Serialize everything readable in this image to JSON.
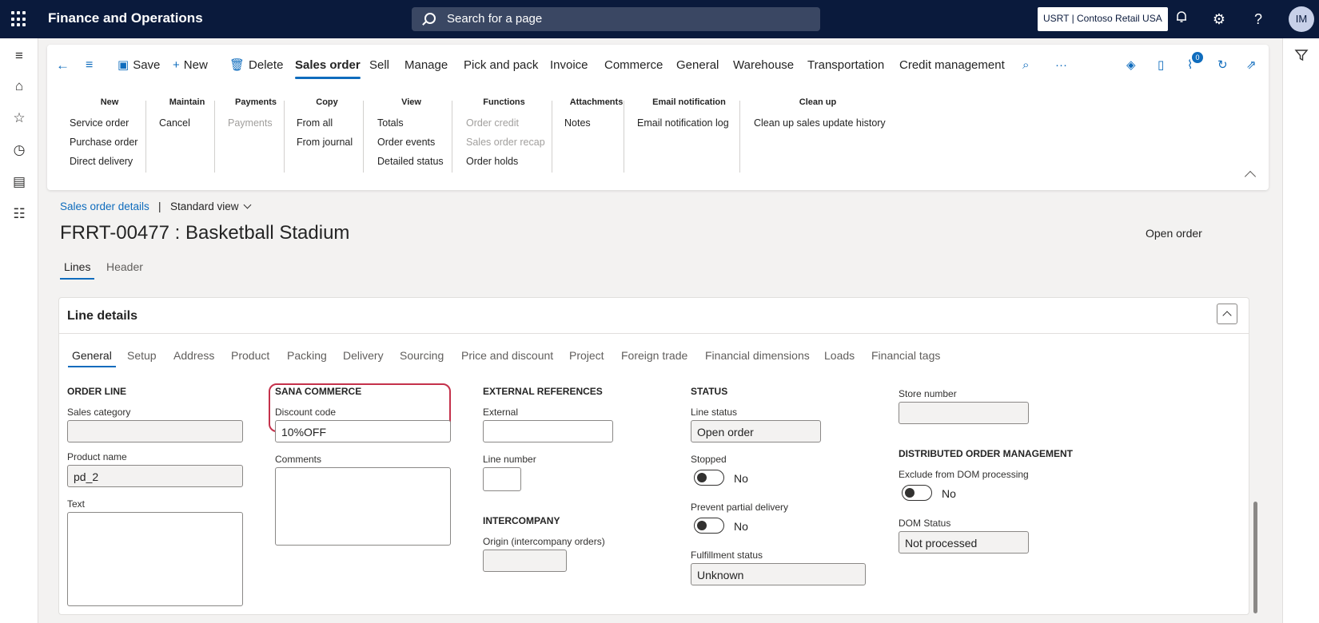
{
  "app": {
    "title": "Finance and Operations",
    "search_placeholder": "Search for a page",
    "company": "USRT | Contoso Retail USA",
    "user_initials": "IM",
    "attachments_count": "0"
  },
  "toolbar": {
    "save": "Save",
    "new": "New",
    "delete": "Delete",
    "tabs": [
      "Sales order",
      "Sell",
      "Manage",
      "Pick and pack",
      "Invoice",
      "Commerce",
      "General",
      "Warehouse",
      "Transportation",
      "Credit management"
    ],
    "more": "···"
  },
  "ribbon": {
    "groups": [
      {
        "header": "New",
        "items": [
          "Service order",
          "Purchase order",
          "Direct delivery"
        ]
      },
      {
        "header": "Maintain",
        "items": [
          "Cancel"
        ]
      },
      {
        "header": "Payments",
        "items": [
          "Payments"
        ]
      },
      {
        "header": "Copy",
        "items": [
          "From all",
          "From journal"
        ]
      },
      {
        "header": "View",
        "items": [
          "Totals",
          "Order events",
          "Detailed status"
        ]
      },
      {
        "header": "Functions",
        "items": [
          "Order credit",
          "Sales order recap",
          "Order holds"
        ]
      },
      {
        "header": "Attachments",
        "items": [
          "Notes"
        ]
      },
      {
        "header": "Email notification",
        "items": [
          "Email notification log"
        ]
      },
      {
        "header": "Clean up",
        "items": [
          "Clean up sales update history"
        ]
      }
    ]
  },
  "page": {
    "breadcrumb": "Sales order details",
    "separator": "|",
    "view": "Standard view",
    "title": "FRRT-00477 : Basketball Stadium",
    "status": "Open order",
    "tabs": [
      "Lines",
      "Header"
    ]
  },
  "line_details": {
    "header": "Line details",
    "tabs": [
      "General",
      "Setup",
      "Address",
      "Product",
      "Packing",
      "Delivery",
      "Sourcing",
      "Price and discount",
      "Project",
      "Foreign trade",
      "Financial dimensions",
      "Loads",
      "Financial tags"
    ],
    "order_line": {
      "section": "ORDER LINE",
      "sales_category_label": "Sales category",
      "sales_category": "",
      "product_name_label": "Product name",
      "product_name": "pd_2",
      "text_label": "Text"
    },
    "sana": {
      "section": "SANA COMMERCE",
      "discount_code_label": "Discount code",
      "discount_code": "10%OFF",
      "comments_label": "Comments"
    },
    "external": {
      "section": "EXTERNAL REFERENCES",
      "external_label": "External",
      "line_number_label": "Line number"
    },
    "intercompany": {
      "section": "INTERCOMPANY",
      "origin_label": "Origin (intercompany orders)"
    },
    "status": {
      "section": "STATUS",
      "line_status_label": "Line status",
      "line_status": "Open order",
      "stopped_label": "Stopped",
      "stopped": "No",
      "prevent_partial_label": "Prevent partial delivery",
      "prevent_partial": "No",
      "fulfillment_label": "Fulfillment status",
      "fulfillment": "Unknown"
    },
    "store": {
      "store_number_label": "Store number"
    },
    "dom": {
      "section": "DISTRIBUTED ORDER MANAGEMENT",
      "exclude_label": "Exclude from DOM processing",
      "exclude": "No",
      "dom_status_label": "DOM Status",
      "dom_status": "Not processed"
    }
  }
}
